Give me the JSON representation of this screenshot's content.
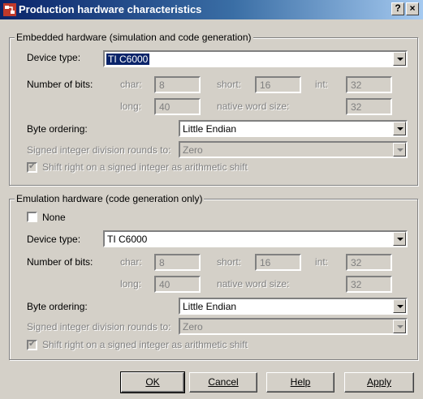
{
  "window": {
    "title": "Production hardware characteristics",
    "help_button": "?",
    "close_button": "×",
    "icon": "simulink-app-icon"
  },
  "embedded": {
    "legend": "Embedded hardware (simulation and code generation)",
    "device_type_label": "Device type:",
    "device_type_value": "TI C6000",
    "bits_label": "Number of bits:",
    "char_label": "char:",
    "char_value": "8",
    "short_label": "short:",
    "short_value": "16",
    "int_label": "int:",
    "int_value": "32",
    "long_label": "long:",
    "long_value": "40",
    "native_label": "native word size:",
    "native_value": "32",
    "byte_order_label": "Byte ordering:",
    "byte_order_value": "Little Endian",
    "division_label": "Signed integer division rounds to:",
    "division_value": "Zero",
    "shift_label": "Shift right on a signed integer as arithmetic shift"
  },
  "emulation": {
    "legend": "Emulation hardware (code generation only)",
    "none_label": "None",
    "device_type_label": "Device type:",
    "device_type_value": "TI C6000",
    "bits_label": "Number of bits:",
    "char_label": "char:",
    "char_value": "8",
    "short_label": "short:",
    "short_value": "16",
    "int_label": "int:",
    "int_value": "32",
    "long_label": "long:",
    "long_value": "40",
    "native_label": "native word size:",
    "native_value": "32",
    "byte_order_label": "Byte ordering:",
    "byte_order_value": "Little Endian",
    "division_label": "Signed integer division rounds to:",
    "division_value": "Zero",
    "shift_label": "Shift right on a signed integer as arithmetic shift"
  },
  "buttons": {
    "ok": "OK",
    "cancel": "Cancel",
    "help": "Help",
    "apply": "Apply"
  }
}
